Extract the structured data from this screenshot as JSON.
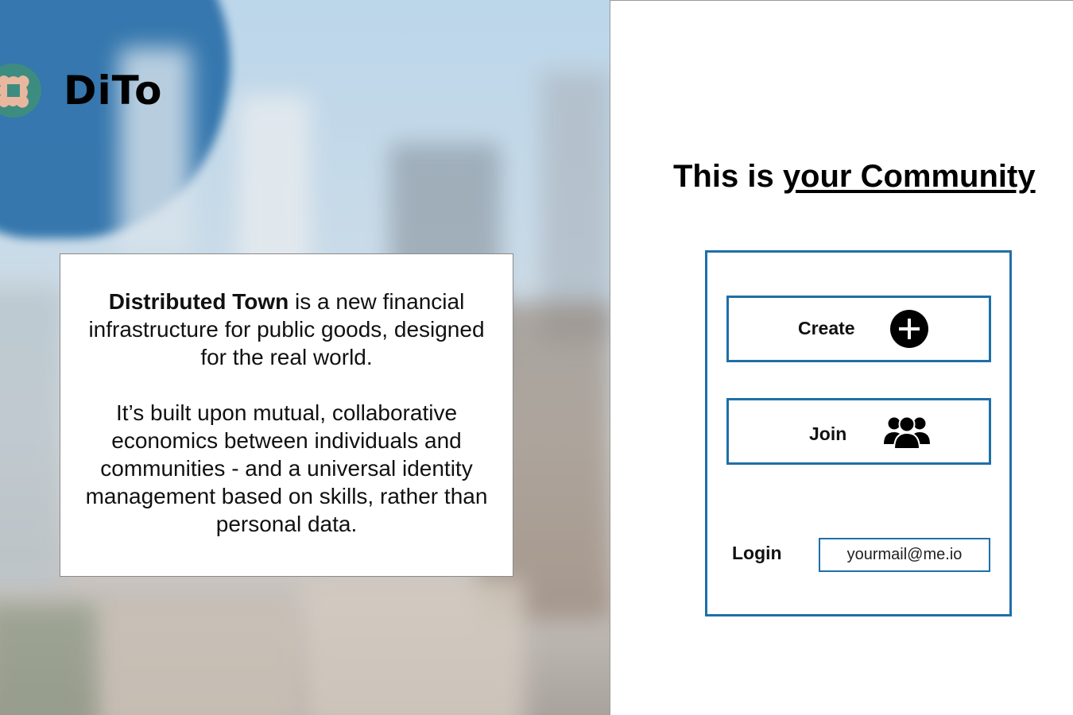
{
  "brand": {
    "name": "DiTo",
    "accent": "#1f6fa8",
    "logo_color": "#3d8c80"
  },
  "info": {
    "bold_lead": "Distributed Town",
    "para1_rest": " is a new financial infrastructure for public goods, designed for the real world.",
    "para2": "It’s built upon mutual, collaborative economics between individuals and communities - and a universal identity management based on skills, rather than personal data."
  },
  "headline": {
    "prefix": "This is ",
    "emphasis": "your Community"
  },
  "actions": {
    "create_label": "Create",
    "create_icon": "plus-circle-icon",
    "join_label": "Join",
    "join_icon": "users-icon"
  },
  "login": {
    "label": "Login",
    "placeholder": "yourmail@me.io"
  }
}
